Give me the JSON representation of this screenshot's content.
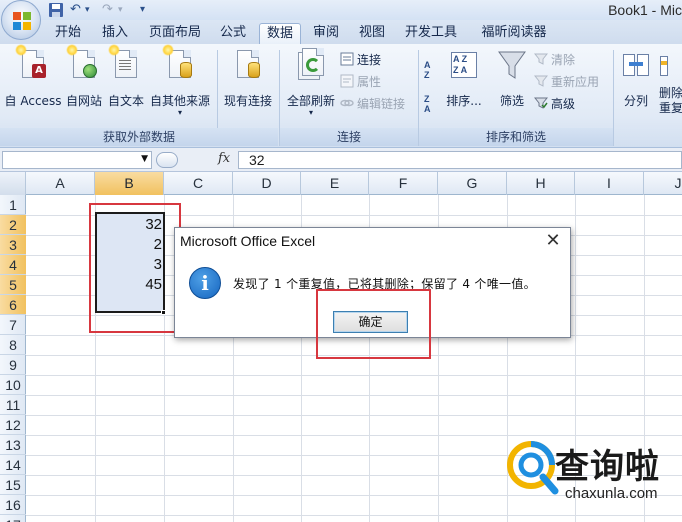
{
  "window": {
    "title": "Book1 - Mic",
    "qat": {
      "save_icon": "save-icon",
      "undo_icon": "undo-icon",
      "redo_icon": "redo-icon",
      "undo_glyph": "↶",
      "redo_glyph": "↷",
      "customize_glyph": "▾"
    }
  },
  "tabs": [
    {
      "label": "开始"
    },
    {
      "label": "插入"
    },
    {
      "label": "页面布局"
    },
    {
      "label": "公式"
    },
    {
      "label": "数据",
      "active": true
    },
    {
      "label": "审阅"
    },
    {
      "label": "视图"
    },
    {
      "label": "开发工具"
    },
    {
      "label": "福昕阅读器"
    }
  ],
  "ribbon": {
    "get_external_data": {
      "label": "获取外部数据",
      "buttons": [
        {
          "label": "自 Access",
          "icon": "access-icon"
        },
        {
          "label": "自网站",
          "icon": "web-icon"
        },
        {
          "label": "自文本",
          "icon": "text-file-icon"
        },
        {
          "label": "自其他来源",
          "icon": "other-sources-icon",
          "dropdown": "▾"
        },
        {
          "label": "现有连接",
          "icon": "existing-connections-icon"
        }
      ]
    },
    "connections": {
      "label": "连接",
      "refresh_all": "全部刷新",
      "refresh_dropdown": "▾",
      "connections_btn": "连接",
      "properties": "属性",
      "edit_links": "编辑链接"
    },
    "sort_filter": {
      "label": "排序和筛选",
      "sort": "排序...",
      "filter": "筛选",
      "clear": "清除",
      "reapply": "重新应用",
      "advanced": "高级",
      "az_top": "A",
      "az_bottom": "Z",
      "za_top": "Z",
      "za_bottom": "A"
    },
    "data_tools": {
      "split": "分列",
      "remove_dup_top": "删除",
      "remove_dup_bottom": "重复"
    }
  },
  "formula_bar": {
    "fx": "fx",
    "value": "32",
    "namebox_arrow": "▼"
  },
  "grid": {
    "columns": [
      "A",
      "B",
      "C",
      "D",
      "E",
      "F",
      "G",
      "H",
      "I",
      "J"
    ],
    "selected_column": "B",
    "rows": [
      "1",
      "2",
      "3",
      "4",
      "5",
      "6",
      "7",
      "8",
      "9",
      "10",
      "11",
      "12",
      "13",
      "14",
      "15",
      "16",
      "17"
    ],
    "selected_rows": [
      "2",
      "3",
      "4",
      "5",
      "6"
    ],
    "b_values": [
      "32",
      "2",
      "3",
      "45"
    ]
  },
  "dialog": {
    "title": "Microsoft Office Excel",
    "close": "✕",
    "icon": "info-icon",
    "icon_glyph": "i",
    "message": "发现了 1 个重复值，已将其删除；保留了 4 个唯一值。",
    "ok_label": "确定"
  },
  "watermark": {
    "text": "查询啦",
    "url": "chaxunla.com"
  },
  "colors": {
    "highlight": "#d7373f",
    "selection_fill": "#dde6f4",
    "header_selected": "#f1c15f"
  }
}
